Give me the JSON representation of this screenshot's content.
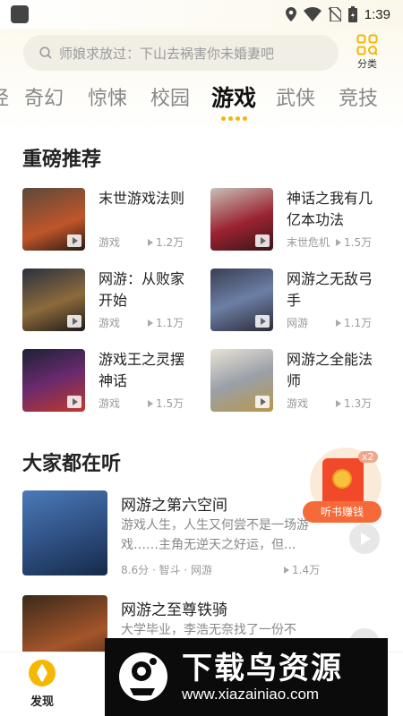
{
  "status_bar": {
    "time": "1:39"
  },
  "search": {
    "placeholder": "师娘求放过：下山去祸害你未婚妻吧"
  },
  "category_button": {
    "label": "分类"
  },
  "tabs": [
    {
      "label": "经"
    },
    {
      "label": "奇幻"
    },
    {
      "label": "惊悚"
    },
    {
      "label": "校园"
    },
    {
      "label": "游戏",
      "active": true
    },
    {
      "label": "武侠"
    },
    {
      "label": "竞技"
    }
  ],
  "recommended": {
    "title": "重磅推荐",
    "items": [
      {
        "title": "末世游戏法则",
        "genre": "游戏",
        "plays": "1.2万"
      },
      {
        "title": "神话之我有几亿本功法",
        "genre": "末世危机",
        "plays": "1.5万"
      },
      {
        "title": "网游：从败家开始",
        "genre": "游戏",
        "plays": "1.1万"
      },
      {
        "title": "网游之无敌弓手",
        "genre": "网游",
        "plays": "1.1万"
      },
      {
        "title": "游戏王之灵摆神话",
        "genre": "游戏",
        "plays": "1.5万"
      },
      {
        "title": "网游之全能法师",
        "genre": "游戏",
        "plays": "1.3万"
      }
    ]
  },
  "listen": {
    "title": "大家都在听",
    "items": [
      {
        "title": "网游之第六空间",
        "desc": "游戏人生，人生又何尝不是一场游戏……主角无逆天之好运，但...",
        "meta": "8.6分 · 智斗 · 网游",
        "plays": "1.4万"
      },
      {
        "title": "网游之至尊铁骑",
        "desc": "大学毕业，李浩无奈找了一份不",
        "meta": "",
        "plays": ""
      }
    ]
  },
  "reward": {
    "badge": "x2",
    "label": "听书赚钱"
  },
  "bottom_nav": {
    "discover_label": "发现"
  },
  "watermark": {
    "title": "下载鸟资源",
    "url": "www.xiazainiao.com"
  },
  "colors": {
    "accent": "#f5b800",
    "reward": "#f66a3a"
  }
}
